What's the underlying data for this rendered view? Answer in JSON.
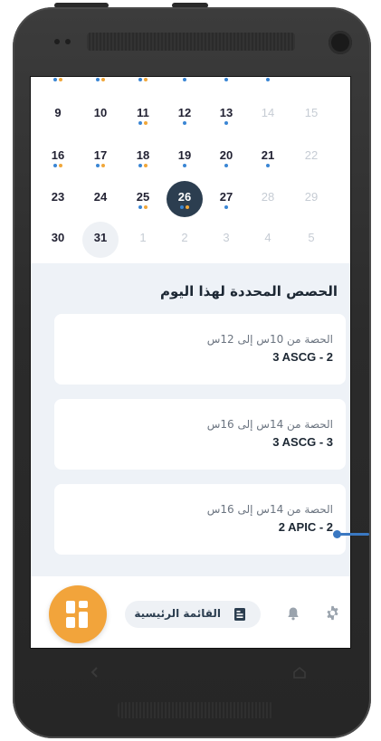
{
  "calendar": {
    "partial_row": [
      {
        "num": "",
        "dots": [
          "blue",
          "orange"
        ]
      },
      {
        "num": "",
        "dots": [
          "blue",
          "orange"
        ]
      },
      {
        "num": "",
        "dots": [
          "blue",
          "orange"
        ]
      },
      {
        "num": "",
        "dots": [
          "blue"
        ]
      },
      {
        "num": "",
        "dots": [
          "blue"
        ]
      },
      {
        "num": "",
        "dots": [
          "blue"
        ]
      },
      {
        "num": "",
        "dots": []
      }
    ],
    "weeks": [
      [
        {
          "num": "9",
          "dots": [],
          "state": "normal"
        },
        {
          "num": "10",
          "dots": [],
          "state": "normal"
        },
        {
          "num": "11",
          "dots": [
            "blue",
            "orange"
          ],
          "state": "normal"
        },
        {
          "num": "12",
          "dots": [
            "blue"
          ],
          "state": "normal"
        },
        {
          "num": "13",
          "dots": [
            "blue"
          ],
          "state": "normal"
        },
        {
          "num": "14",
          "dots": [],
          "state": "muted"
        },
        {
          "num": "15",
          "dots": [],
          "state": "muted"
        }
      ],
      [
        {
          "num": "16",
          "dots": [
            "blue",
            "orange"
          ],
          "state": "normal"
        },
        {
          "num": "17",
          "dots": [
            "blue",
            "orange"
          ],
          "state": "normal"
        },
        {
          "num": "18",
          "dots": [
            "blue",
            "orange"
          ],
          "state": "normal"
        },
        {
          "num": "19",
          "dots": [
            "blue"
          ],
          "state": "normal"
        },
        {
          "num": "20",
          "dots": [
            "blue"
          ],
          "state": "normal"
        },
        {
          "num": "21",
          "dots": [
            "blue"
          ],
          "state": "normal"
        },
        {
          "num": "22",
          "dots": [],
          "state": "muted"
        }
      ],
      [
        {
          "num": "23",
          "dots": [],
          "state": "normal"
        },
        {
          "num": "24",
          "dots": [],
          "state": "normal"
        },
        {
          "num": "25",
          "dots": [
            "blue",
            "orange"
          ],
          "state": "normal"
        },
        {
          "num": "26",
          "dots": [
            "blue",
            "orange"
          ],
          "state": "today"
        },
        {
          "num": "27",
          "dots": [
            "blue"
          ],
          "state": "normal"
        },
        {
          "num": "28",
          "dots": [],
          "state": "muted"
        },
        {
          "num": "29",
          "dots": [],
          "state": "muted"
        }
      ],
      [
        {
          "num": "30",
          "dots": [],
          "state": "normal"
        },
        {
          "num": "31",
          "dots": [],
          "state": "selected"
        },
        {
          "num": "1",
          "dots": [],
          "state": "muted"
        },
        {
          "num": "2",
          "dots": [],
          "state": "muted"
        },
        {
          "num": "3",
          "dots": [],
          "state": "muted"
        },
        {
          "num": "4",
          "dots": [],
          "state": "muted"
        },
        {
          "num": "5",
          "dots": [],
          "state": "muted"
        }
      ]
    ]
  },
  "sessions": {
    "title": "الحصص المحددة لهذا اليوم",
    "items": [
      {
        "time": "الحصة من 10س إلى 12س",
        "class": "3 ASCG - 2"
      },
      {
        "time": "الحصة من 14س إلى 16س",
        "class": "3 ASCG - 3"
      },
      {
        "time": "الحصة من 14س إلى 16س",
        "class": "2 APIC - 2"
      }
    ]
  },
  "bottom_nav": {
    "home_label": "القائمة الرئيسية",
    "fab_icon": "apps-grid-icon",
    "home_icon": "list-icon",
    "bell_icon": "bell-icon",
    "settings_icon": "gear-icon"
  },
  "colors": {
    "accent_orange": "#f2a43b",
    "dot_blue": "#3a86d4",
    "dot_orange": "#f0a73a",
    "today_bg": "#2c3e50",
    "list_bg": "#eef2f7"
  }
}
